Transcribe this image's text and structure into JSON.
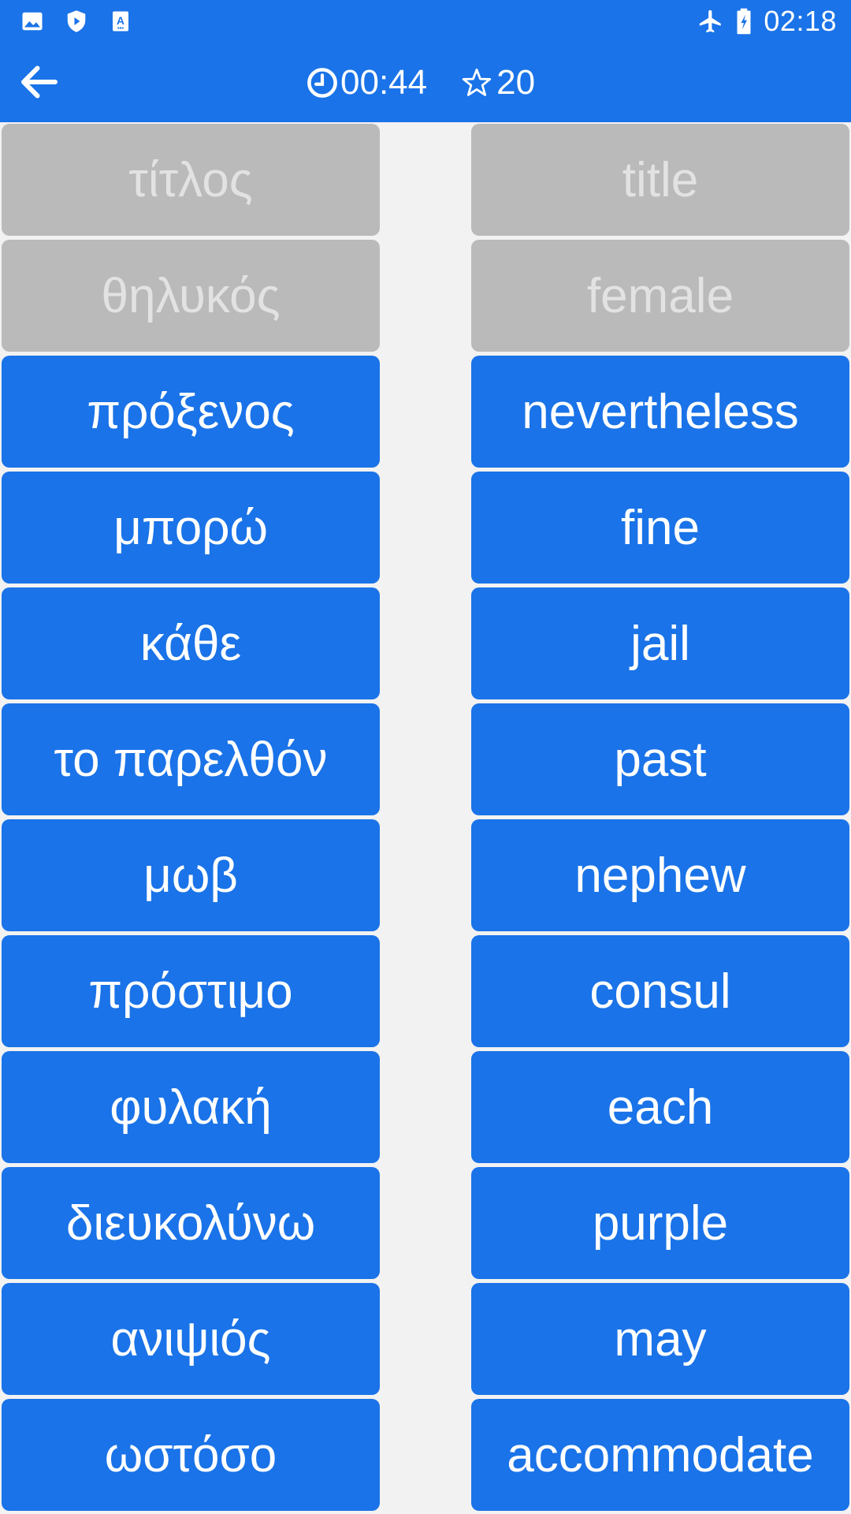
{
  "status_bar": {
    "left_icons": [
      "image-icon",
      "play-protect-icon",
      "accessibility-icon"
    ],
    "right_icons": [
      "airplane-mode-icon",
      "battery-charging-icon"
    ],
    "time": "02:18"
  },
  "toolbar": {
    "back_icon": "arrow-left-icon",
    "timer_icon": "clock-icon",
    "timer": "00:44",
    "score_icon": "star-outline-icon",
    "score": "20"
  },
  "colors": {
    "primary": "#1a73e8",
    "matched_tile": "#bababa",
    "matched_text": "#e2e2e2",
    "background": "#f2f2f2"
  },
  "rows": [
    {
      "greek": "τίτλος",
      "greek_matched": true,
      "english": "title",
      "english_matched": true
    },
    {
      "greek": "θηλυκός",
      "greek_matched": true,
      "english": "female",
      "english_matched": true
    },
    {
      "greek": "πρόξενος",
      "greek_matched": false,
      "english": "nevertheless",
      "english_matched": false
    },
    {
      "greek": "μπορώ",
      "greek_matched": false,
      "english": "fine",
      "english_matched": false
    },
    {
      "greek": "κάθε",
      "greek_matched": false,
      "english": "jail",
      "english_matched": false
    },
    {
      "greek": "το παρελθόν",
      "greek_matched": false,
      "english": "past",
      "english_matched": false
    },
    {
      "greek": "μωβ",
      "greek_matched": false,
      "english": "nephew",
      "english_matched": false
    },
    {
      "greek": "πρόστιμο",
      "greek_matched": false,
      "english": "consul",
      "english_matched": false
    },
    {
      "greek": "φυλακή",
      "greek_matched": false,
      "english": "each",
      "english_matched": false
    },
    {
      "greek": "διευκολύνω",
      "greek_matched": false,
      "english": "purple",
      "english_matched": false
    },
    {
      "greek": "ανιψιός",
      "greek_matched": false,
      "english": "may",
      "english_matched": false
    },
    {
      "greek": "ωστόσο",
      "greek_matched": false,
      "english": "accommodate",
      "english_matched": false
    }
  ]
}
